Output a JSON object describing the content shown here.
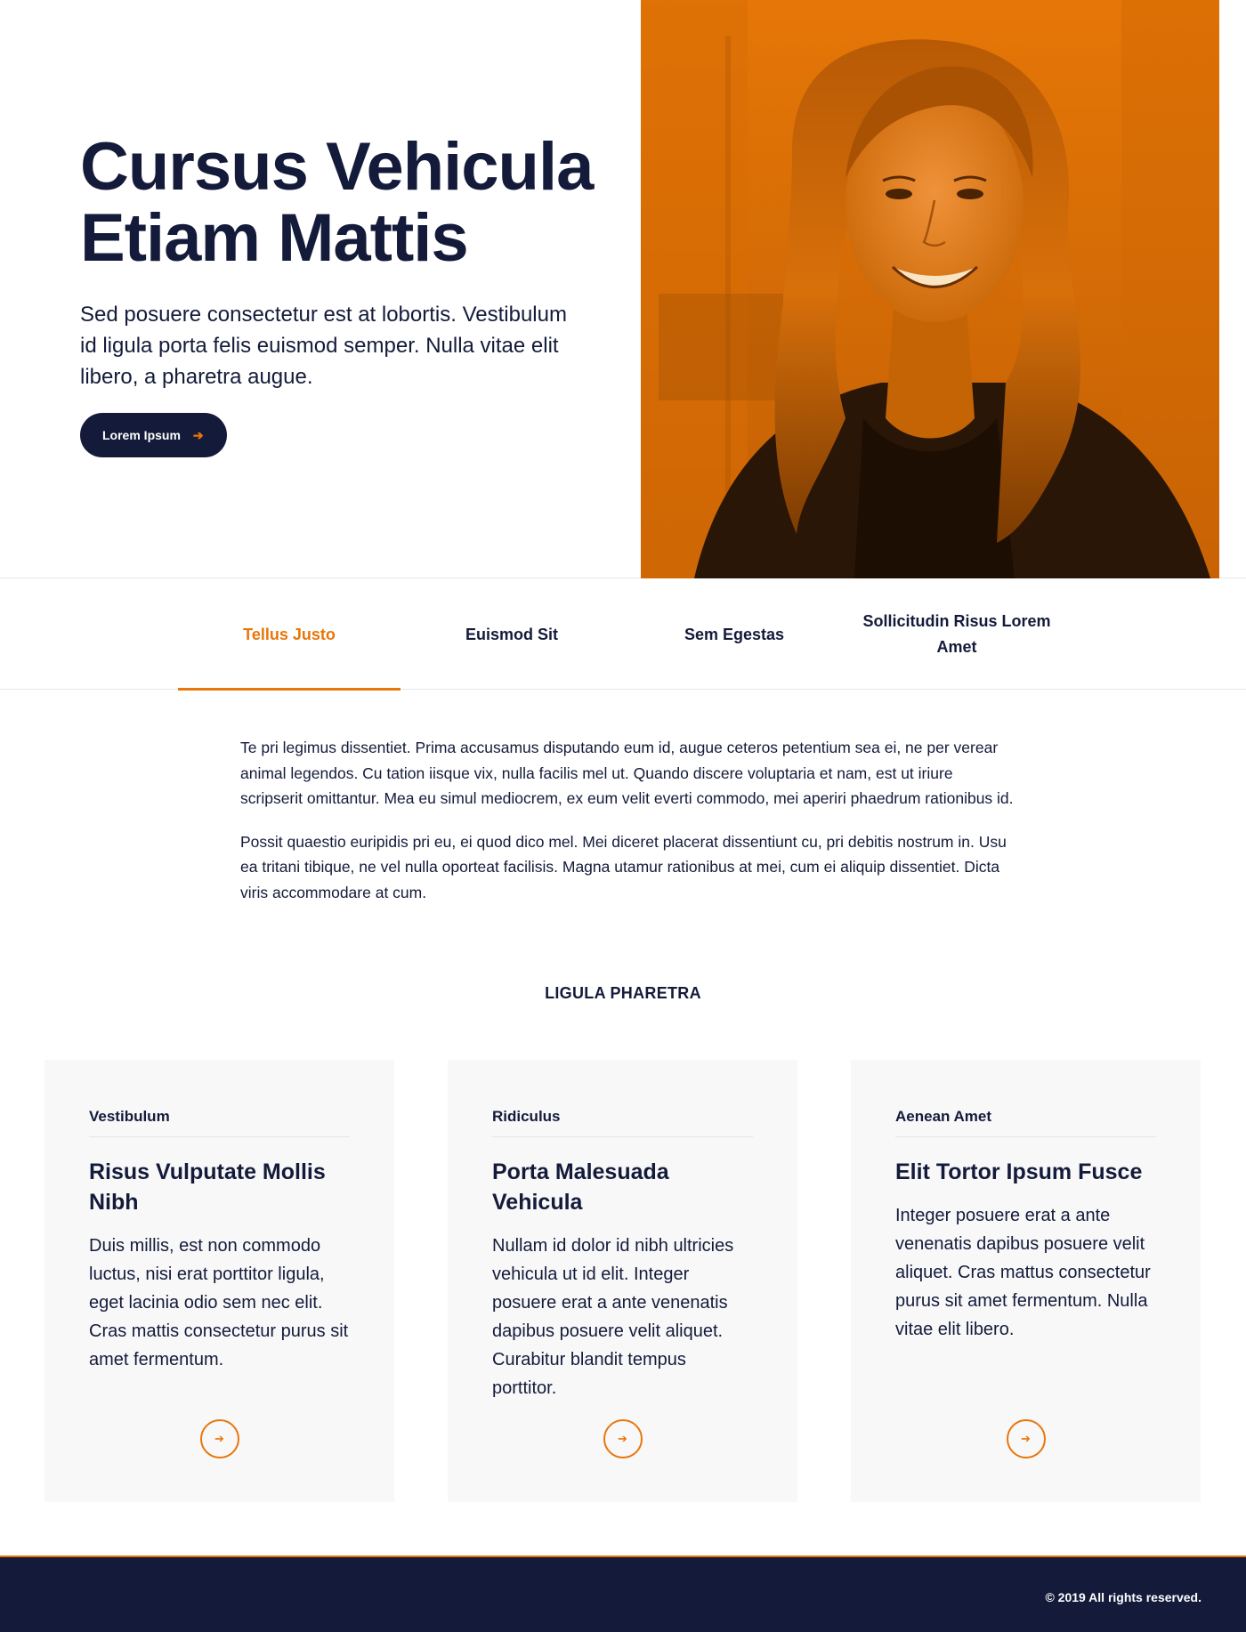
{
  "colors": {
    "accent": "#e8760a",
    "navy": "#141b3a",
    "card_bg": "#f8f8f9"
  },
  "hero": {
    "title_line1": "Cursus Vehicula",
    "title_line2": "Etiam Mattis",
    "subtitle": "Sed posuere consectetur est at lobortis. Vestibulum id ligula porta felis euismod semper. Nulla vitae elit libero, a pharetra augue.",
    "cta_label": "Lorem Ipsum",
    "cta_icon": "arrow-right-icon",
    "photo": "smiling-woman-portrait-orange-duotone"
  },
  "tabs": [
    {
      "label": "Tellus Justo",
      "active": true
    },
    {
      "label": "Euismod Sit",
      "active": false
    },
    {
      "label": "Sem Egestas",
      "active": false
    },
    {
      "label": "Sollicitudin Risus Lorem Amet",
      "active": false
    }
  ],
  "content": {
    "paragraph1": "Te pri legimus dissentiet. Prima accusamus disputando eum id, augue ceteros petentium sea ei, ne per verear animal legendos. Cu tation iisque vix, nulla facilis mel ut. Quando discere voluptaria et nam, est ut iriure scripserit omittantur. Mea eu simul mediocrem, ex eum velit everti commodo, mei aperiri phaedrum rationibus id.",
    "paragraph2": "Possit quaestio euripidis pri eu, ei quod dico mel. Mei diceret placerat dissentiunt cu, pri debitis nostrum in. Usu ea tritani tibique, ne vel nulla oporteat facilisis. Magna utamur rationibus at mei, cum ei aliquip dissentiet. Dicta viris accommodare at cum."
  },
  "section_heading": "LIGULA PHARETRA",
  "cards": [
    {
      "eyebrow": "Vestibulum",
      "title": "Risus Vulputate Mollis Nibh",
      "body": "Duis millis, est non commodo luctus, nisi erat porttitor ligula, eget lacinia odio sem nec elit. Cras mattis consectetur purus sit amet fermentum.",
      "link_icon": "arrow-right-circle-icon"
    },
    {
      "eyebrow": "Ridiculus",
      "title": "Porta Malesuada Vehicula",
      "body": "Nullam id dolor id nibh ultricies vehicula ut id elit. Integer posuere erat a ante venenatis dapibus posuere velit aliquet. Curabitur blandit tempus porttitor.",
      "link_icon": "arrow-right-circle-icon"
    },
    {
      "eyebrow": "Aenean Amet",
      "title": "Elit Tortor Ipsum Fusce",
      "body": "Integer posuere erat a ante venenatis dapibus posuere velit aliquet. Cras mattus consectetur purus sit amet fermentum. Nulla vitae elit libero.",
      "link_icon": "arrow-right-circle-icon"
    }
  ],
  "footer": {
    "copyright": "© 2019 All rights reserved."
  }
}
